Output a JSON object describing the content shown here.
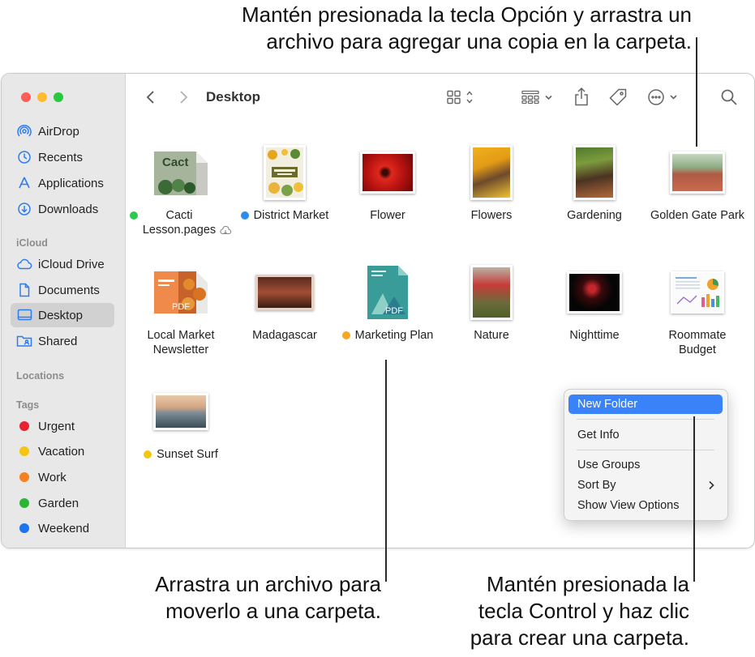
{
  "callouts": {
    "top": "Mantén presionada la tecla Opción y arrastra un\narchivo para agregar una copia en la carpeta.",
    "drag": "Arrastra un archivo para\nmoverlo a una carpeta.",
    "control": "Mantén presionada la\ntecla Control y haz clic\npara crear una carpeta."
  },
  "window": {
    "title": "Desktop",
    "traffic_colors": [
      "#fe5f57",
      "#febc2e",
      "#28c840"
    ],
    "toolbar_icons": [
      "back-icon",
      "forward-icon",
      "icon-view-icon",
      "group-view-icon",
      "share-icon",
      "tag-icon",
      "more-icon",
      "search-icon"
    ]
  },
  "sidebar": {
    "favorites": [
      {
        "label": "AirDrop",
        "icon": "airdrop-icon"
      },
      {
        "label": "Recents",
        "icon": "clock-icon"
      },
      {
        "label": "Applications",
        "icon": "applications-icon"
      },
      {
        "label": "Downloads",
        "icon": "download-icon"
      }
    ],
    "icloud_heading": "iCloud",
    "icloud": [
      {
        "label": "iCloud Drive",
        "icon": "cloud-icon"
      },
      {
        "label": "Documents",
        "icon": "document-icon"
      },
      {
        "label": "Desktop",
        "icon": "desktop-icon",
        "selected": true
      },
      {
        "label": "Shared",
        "icon": "shared-folder-icon"
      }
    ],
    "locations_heading": "Locations",
    "tags_heading": "Tags",
    "tags": [
      {
        "label": "Urgent",
        "color": "#e8232f"
      },
      {
        "label": "Vacation",
        "color": "#f5c511"
      },
      {
        "label": "Work",
        "color": "#f58020"
      },
      {
        "label": "Garden",
        "color": "#2bb534"
      },
      {
        "label": "Weekend",
        "color": "#1a75ee"
      }
    ]
  },
  "files": [
    {
      "label": "Cacti\nLesson.pages",
      "tag": "#2bc950",
      "kind": "pages-doc",
      "cloud": true
    },
    {
      "label": "District Market",
      "tag": "#2d8cf0",
      "kind": "poster"
    },
    {
      "label": "Flower",
      "kind": "photo-red"
    },
    {
      "label": "Flowers",
      "kind": "photo-portrait"
    },
    {
      "label": "Gardening",
      "kind": "photo-portrait-green"
    },
    {
      "label": "Golden Gate Park",
      "kind": "photo-landscape-track"
    },
    {
      "label": "Local Market\nNewsletter",
      "kind": "pdf-orange"
    },
    {
      "label": "Madagascar",
      "kind": "keynote"
    },
    {
      "label": "Marketing Plan",
      "tag": "#f5a623",
      "kind": "pdf-teal"
    },
    {
      "label": "Nature",
      "kind": "photo-portrait-red"
    },
    {
      "label": "Nighttime",
      "kind": "photo-night"
    },
    {
      "label": "Roommate\nBudget",
      "kind": "numbers"
    },
    {
      "label": "Sunset Surf",
      "tag": "#f5c511",
      "kind": "photo-sunset"
    }
  ],
  "pdf_label": "PDF",
  "context_menu": {
    "items": [
      "New Folder",
      "Get Info",
      "Use Groups",
      "Sort By",
      "Show View Options"
    ],
    "highlighted": "New Folder",
    "submenu_icon": "chevron-right-icon"
  }
}
